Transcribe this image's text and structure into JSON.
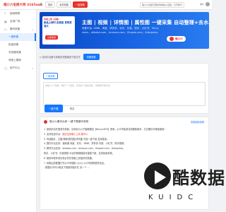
{
  "app": {
    "title": "喵小六电商大师 3165aaS"
  },
  "topbar": {
    "menu_icon": "☰",
    "tabs": [
      {
        "label": "首页"
      },
      {
        "label": "素材采集"
      },
      {
        "label": "一键采集",
        "active": true
      }
    ],
    "notice": "喵小六全部已更新到微信小店版，打开即可",
    "user": "用户"
  },
  "sidebar": {
    "items": [
      {
        "label": "使用帮助",
        "icon": "?"
      },
      {
        "label": "应用广场",
        "icon": "▦"
      },
      {
        "label": "素材采集",
        "icon": "☐",
        "group": true
      },
      {
        "label": "一键采集",
        "sub": true,
        "active": true
      },
      {
        "label": "批量采集",
        "sub": true
      },
      {
        "label": "浏览器采集",
        "sub": true
      },
      {
        "label": "淘宝上搬家",
        "sub": true
      },
      {
        "label": "用户中心",
        "icon": "◯",
        "group": true
      }
    ]
  },
  "banner": {
    "tag": "电商上新 (采集)",
    "sub": "新品上架时 赶紧装 更快更强大",
    "btn": "立即使用",
    "title": "主图 | 视频 | 详情图 | 属性图 一键采集 自动整理+去水印",
    "line2": "采集平台: 1688、淘宝、拼多多、京东、抖音、快手、小红书、Temu、",
    "line3": "shein、alibaba.com、Amazon.com、Shopee.com、Aliexpress.",
    "brand": "喵小六"
  },
  "tip": {
    "text": "⊙ 支持平台数与采集页完整版到下载方式",
    "btn": "完美采集"
  },
  "card": {
    "tab": "一键采集",
    "placeholder": "请输入1个链接，每行一个链接，支持多个链接采集，请按换行键分割",
    "primary_btn": "一键下载",
    "plain_btn": "清空"
  },
  "info": {
    "title": "喵小六素材大师 一键下载操作说明",
    "link": "查看使用说明",
    "lines": [
      {
        "text": "1. 使用前请先登录付费版，请添加小六子客服微信【BanyuXFN】咨询；公众号免费试用更新版本，已过期仍可继续使用！"
      },
      {
        "text": "2. 支持在线平台：",
        "red": "图文及采集小工具 都可以"
      },
      {
        "text": "3. 商品图片、主图/视频/属性图/详情图 可选一键下载 支持批量；"
      },
      {
        "text": "4. 国内平台支持：速卖通 淘宝、京东、1688、拼多多 抖音、小红书、快手视频；"
      },
      {
        "text": "5. 跨境平台支持：alibaba.com、Amazon.com、Shopee.com、Aliexpress、"
      },
      {
        "text": "   快手、小红书、抖音视频 平台的视频链接可直接下载，支持批量采集；"
      },
      {
        "text": "6. 使用本软件前请务必先在电脑上安装好浏览器；"
      },
      {
        "text": "7. 采集后的数据打开公众号搜索 (小六) 公众号获取更多信息；"
      },
      {
        "text": "- 数据大字可以取走下载保存图片在 另一个 …"
      }
    ]
  },
  "watermark": {
    "text": "酷数据",
    "sub": "KUIDC"
  }
}
